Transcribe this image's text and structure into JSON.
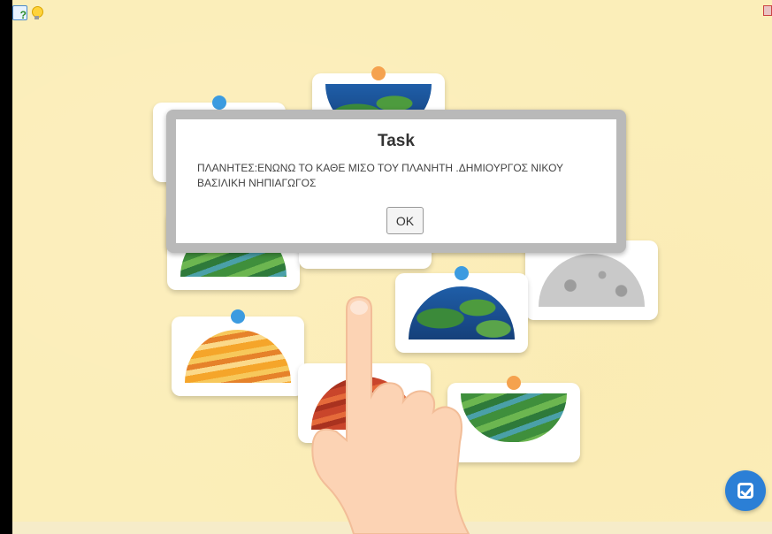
{
  "toolbar": {
    "help_icon": "help-question-icon",
    "hint_icon": "lightbulb-icon",
    "fullscreen_icon": "fullscreen-toggle-icon"
  },
  "dialog": {
    "title": "Task",
    "message": "ΠΛΑΝΗΤΕΣ:ΕΝΩΝΩ ΤΟ ΚΑΘΕ ΜΙΣΟ ΤΟΥ ΠΛΑΝΗΤΗ .ΔΗΜΙΟΥΡΓΟΣ ΝΙΚΟΥ ΒΑΣΙΛΙΚΗ ΝΗΠΙΑΓΩΓΟΣ",
    "ok_label": "OK"
  },
  "cards": [
    {
      "planet": "earth",
      "half": "bottom",
      "pin": "orange"
    },
    {
      "planet": "unknown",
      "half": "hidden",
      "pin": "blue"
    },
    {
      "planet": "neptune",
      "half": "top",
      "pin": "none"
    },
    {
      "planet": "unknown",
      "half": "hidden",
      "pin": "none"
    },
    {
      "planet": "moon",
      "half": "top",
      "pin": "none"
    },
    {
      "planet": "earth",
      "half": "top",
      "pin": "blue"
    },
    {
      "planet": "jupiter",
      "half": "top",
      "pin": "blue"
    },
    {
      "planet": "mars",
      "half": "top",
      "pin": "none"
    },
    {
      "planet": "neptune",
      "half": "bottom",
      "pin": "orange"
    }
  ],
  "check_button_icon": "check-icon",
  "colors": {
    "background": "#fbeeb9",
    "pin_blue": "#3c9be0",
    "pin_orange": "#f5a24f",
    "check_button": "#2b7fd6"
  }
}
